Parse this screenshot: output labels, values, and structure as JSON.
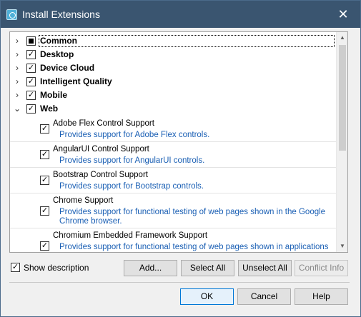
{
  "window": {
    "title": "Install Extensions",
    "close_symbol": "✕"
  },
  "groups": [
    {
      "label": "Common",
      "expander": "›",
      "check": "partial"
    },
    {
      "label": "Desktop",
      "expander": "›",
      "check": "✓"
    },
    {
      "label": "Device Cloud",
      "expander": "›",
      "check": "✓"
    },
    {
      "label": "Intelligent Quality",
      "expander": "›",
      "check": "✓"
    },
    {
      "label": "Mobile",
      "expander": "›",
      "check": "✓"
    },
    {
      "label": "Web",
      "expander": "⌄",
      "check": "✓"
    }
  ],
  "extensions": [
    {
      "name": "Adobe Flex Control Support",
      "check": "✓",
      "description": "Provides support for Adobe Flex controls."
    },
    {
      "name": "AngularUI Control Support",
      "check": "✓",
      "description": "Provides support for AngularUI controls."
    },
    {
      "name": "Bootstrap Control Support",
      "check": "✓",
      "description": "Provides support for Bootstrap controls."
    },
    {
      "name": "Chrome Support",
      "check": "✓",
      "description": "Provides support for functional testing of web pages shown in the Google Chrome browser."
    },
    {
      "name": "Chromium Embedded Framework Support",
      "check": "✓",
      "description": "Provides support for functional testing of web pages shown in applications based on the Chromium Embedded Framework."
    }
  ],
  "scrollbar": {
    "up": "▲",
    "down": "▼"
  },
  "footer": {
    "show_description_label": "Show description",
    "show_description_check": "✓",
    "add_label": "Add...",
    "select_all_label": "Select All",
    "unselect_all_label": "Unselect All",
    "conflict_info_label": "Conflict Info",
    "ok_label": "OK",
    "cancel_label": "Cancel",
    "help_label": "Help"
  },
  "colors": {
    "titlebar": "#3a5570",
    "link": "#1a5fb4",
    "focus_border": "#0078d7"
  }
}
